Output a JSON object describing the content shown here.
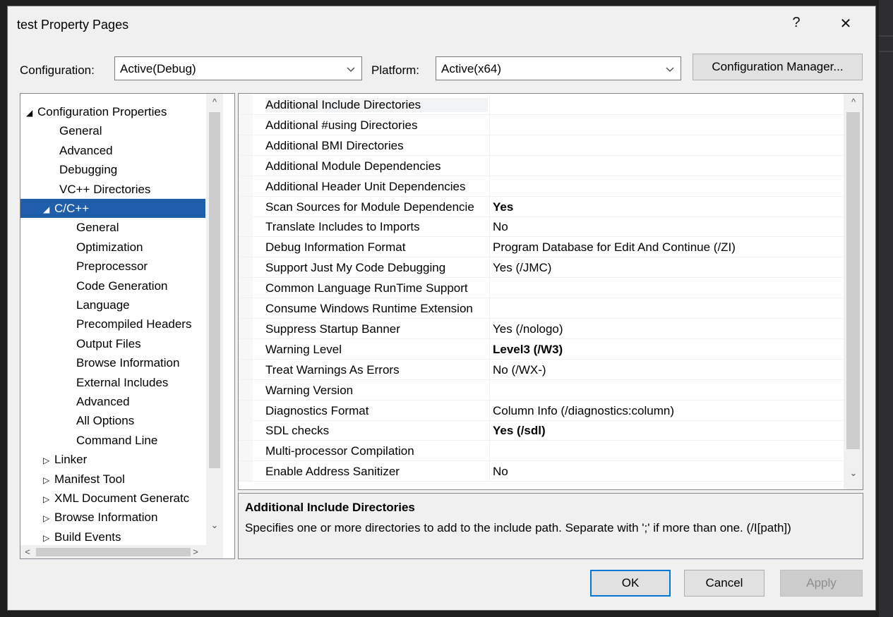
{
  "dialog": {
    "title": "test Property Pages",
    "help_glyph": "?",
    "close_glyph": "✕"
  },
  "config_bar": {
    "configuration_label": "Configuration:",
    "configuration_value": "Active(Debug)",
    "platform_label": "Platform:",
    "platform_value": "Active(x64)",
    "config_manager_button": "Configuration Manager..."
  },
  "tree": {
    "items": [
      {
        "label": "Configuration Properties",
        "expander": "◢"
      },
      {
        "label": "General",
        "expander": ""
      },
      {
        "label": "Advanced",
        "expander": ""
      },
      {
        "label": "Debugging",
        "expander": ""
      },
      {
        "label": "VC++ Directories",
        "expander": ""
      },
      {
        "label": "C/C++",
        "expander": "◢"
      },
      {
        "label": "General",
        "expander": ""
      },
      {
        "label": "Optimization",
        "expander": ""
      },
      {
        "label": "Preprocessor",
        "expander": ""
      },
      {
        "label": "Code Generation",
        "expander": ""
      },
      {
        "label": "Language",
        "expander": ""
      },
      {
        "label": "Precompiled Headers",
        "expander": ""
      },
      {
        "label": "Output Files",
        "expander": ""
      },
      {
        "label": "Browse Information",
        "expander": ""
      },
      {
        "label": "External Includes",
        "expander": ""
      },
      {
        "label": "Advanced",
        "expander": ""
      },
      {
        "label": "All Options",
        "expander": ""
      },
      {
        "label": "Command Line",
        "expander": ""
      },
      {
        "label": "Linker",
        "expander": "▷"
      },
      {
        "label": "Manifest Tool",
        "expander": "▷"
      },
      {
        "label": "XML Document Generatc",
        "expander": "▷"
      },
      {
        "label": "Browse Information",
        "expander": "▷"
      },
      {
        "label": "Build Events",
        "expander": "▷"
      }
    ],
    "selected": "C/C++"
  },
  "properties": {
    "rows": [
      {
        "name": "Additional Include Directories",
        "value": "",
        "bold": false
      },
      {
        "name": "Additional #using Directories",
        "value": "",
        "bold": false
      },
      {
        "name": "Additional BMI Directories",
        "value": "",
        "bold": false
      },
      {
        "name": "Additional Module Dependencies",
        "value": "",
        "bold": false
      },
      {
        "name": "Additional Header Unit Dependencies",
        "value": "",
        "bold": false
      },
      {
        "name": "Scan Sources for Module Dependencie",
        "value": "Yes",
        "bold": true
      },
      {
        "name": "Translate Includes to Imports",
        "value": "No",
        "bold": false
      },
      {
        "name": "Debug Information Format",
        "value": "Program Database for Edit And Continue (/ZI)",
        "bold": false
      },
      {
        "name": "Support Just My Code Debugging",
        "value": "Yes (/JMC)",
        "bold": false
      },
      {
        "name": "Common Language RunTime Support",
        "value": "",
        "bold": false
      },
      {
        "name": "Consume Windows Runtime Extension",
        "value": "",
        "bold": false
      },
      {
        "name": "Suppress Startup Banner",
        "value": "Yes (/nologo)",
        "bold": false
      },
      {
        "name": "Warning Level",
        "value": "Level3 (/W3)",
        "bold": true
      },
      {
        "name": "Treat Warnings As Errors",
        "value": "No (/WX-)",
        "bold": false
      },
      {
        "name": "Warning Version",
        "value": "",
        "bold": false
      },
      {
        "name": "Diagnostics Format",
        "value": "Column Info (/diagnostics:column)",
        "bold": false
      },
      {
        "name": "SDL checks",
        "value": "Yes (/sdl)",
        "bold": true
      },
      {
        "name": "Multi-processor Compilation",
        "value": "",
        "bold": false
      },
      {
        "name": "Enable Address Sanitizer",
        "value": "No",
        "bold": false
      }
    ]
  },
  "description": {
    "title": "Additional Include Directories",
    "text": "Specifies one or more directories to add to the include path. Separate with ';' if more than one. (/I[path])"
  },
  "buttons": {
    "ok": "OK",
    "cancel": "Cancel",
    "apply": "Apply"
  },
  "icons": {
    "scroll_up": "^",
    "scroll_down": "⌄",
    "scroll_left": "<",
    "scroll_right": ">"
  }
}
